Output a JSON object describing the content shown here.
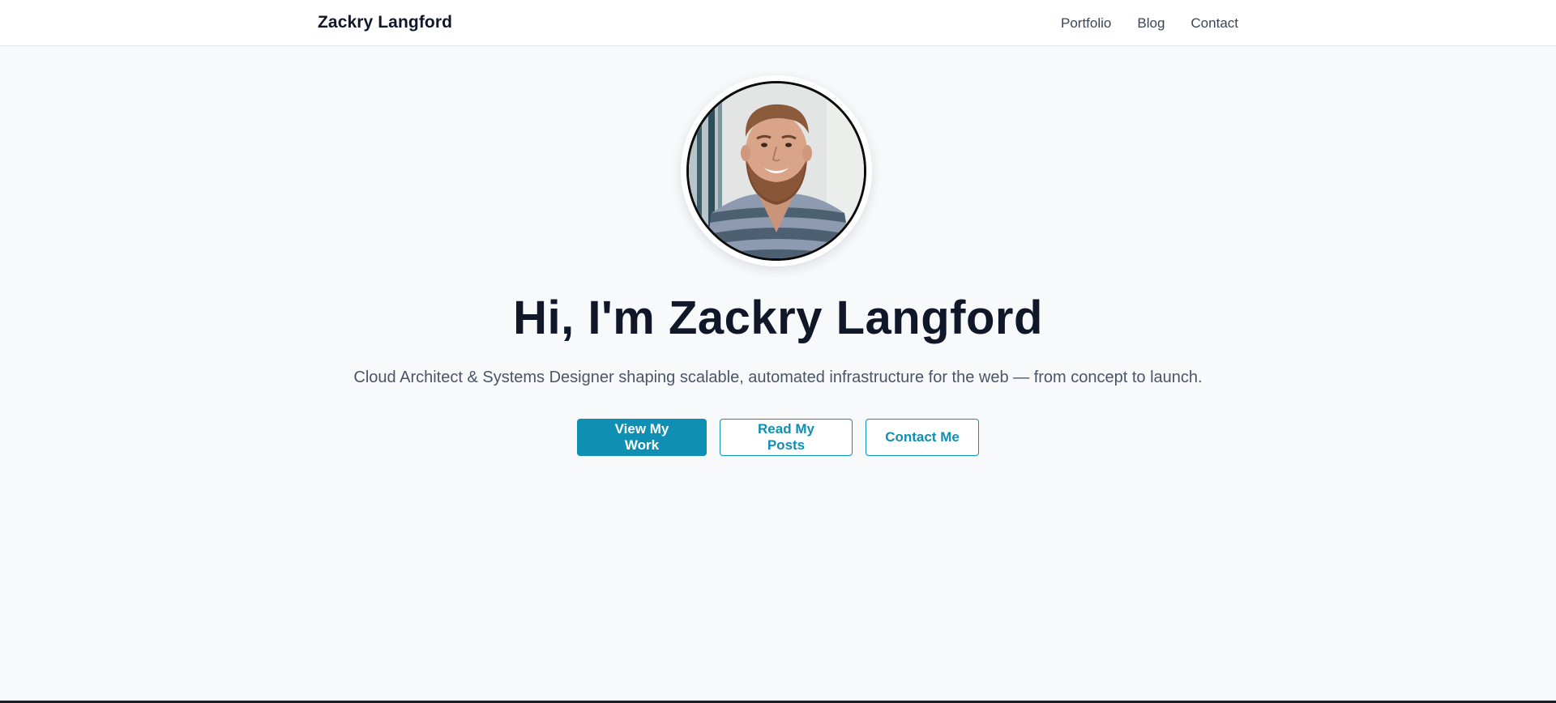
{
  "nav": {
    "brand": "Zackry Langford",
    "links": [
      {
        "label": "Portfolio"
      },
      {
        "label": "Blog"
      },
      {
        "label": "Contact"
      }
    ]
  },
  "hero": {
    "avatar_alt": "profile-photo",
    "headline": "Hi, I'm Zackry Langford",
    "tagline": "Cloud Architect & Systems Designer shaping scalable, automated infrastructure for the web — from concept to launch.",
    "buttons": {
      "primary": "View My Work",
      "posts": "Read My Posts",
      "contact": "Contact Me"
    }
  },
  "colors": {
    "accent": "#0e8fb3",
    "heading": "#0f1729",
    "body_text": "#4a5567",
    "page_bg": "#f8f9fb"
  }
}
